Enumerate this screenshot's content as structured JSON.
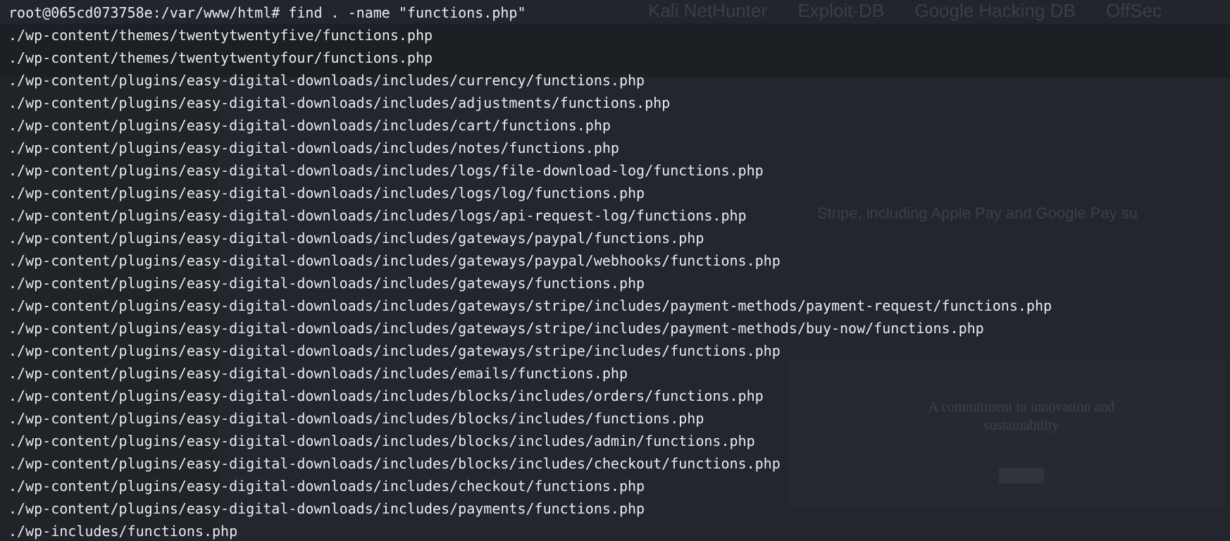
{
  "background": {
    "bookmarks": [
      "Kali NetHunter",
      "Exploit-DB",
      "Google Hacking DB",
      "OffSec"
    ],
    "fragment_text": "Stripe, including Apple Pay and Google Pay su",
    "card_title": "A commitment to innovation and sustainability"
  },
  "terminal": {
    "prompt": "root@065cd073758e:/var/www/html#",
    "command": " find . -name \"functions.php\"",
    "output": [
      "./wp-content/themes/twentytwentyfive/functions.php",
      "./wp-content/themes/twentytwentyfour/functions.php",
      "./wp-content/plugins/easy-digital-downloads/includes/currency/functions.php",
      "./wp-content/plugins/easy-digital-downloads/includes/adjustments/functions.php",
      "./wp-content/plugins/easy-digital-downloads/includes/cart/functions.php",
      "./wp-content/plugins/easy-digital-downloads/includes/notes/functions.php",
      "./wp-content/plugins/easy-digital-downloads/includes/logs/file-download-log/functions.php",
      "./wp-content/plugins/easy-digital-downloads/includes/logs/log/functions.php",
      "./wp-content/plugins/easy-digital-downloads/includes/logs/api-request-log/functions.php",
      "./wp-content/plugins/easy-digital-downloads/includes/gateways/paypal/functions.php",
      "./wp-content/plugins/easy-digital-downloads/includes/gateways/paypal/webhooks/functions.php",
      "./wp-content/plugins/easy-digital-downloads/includes/gateways/functions.php",
      "./wp-content/plugins/easy-digital-downloads/includes/gateways/stripe/includes/payment-methods/payment-request/functions.php",
      "./wp-content/plugins/easy-digital-downloads/includes/gateways/stripe/includes/payment-methods/buy-now/functions.php",
      "./wp-content/plugins/easy-digital-downloads/includes/gateways/stripe/includes/functions.php",
      "./wp-content/plugins/easy-digital-downloads/includes/emails/functions.php",
      "./wp-content/plugins/easy-digital-downloads/includes/blocks/includes/orders/functions.php",
      "./wp-content/plugins/easy-digital-downloads/includes/blocks/includes/functions.php",
      "./wp-content/plugins/easy-digital-downloads/includes/blocks/includes/admin/functions.php",
      "./wp-content/plugins/easy-digital-downloads/includes/blocks/includes/checkout/functions.php",
      "./wp-content/plugins/easy-digital-downloads/includes/checkout/functions.php",
      "./wp-content/plugins/easy-digital-downloads/includes/payments/functions.php",
      "./wp-includes/functions.php"
    ]
  }
}
